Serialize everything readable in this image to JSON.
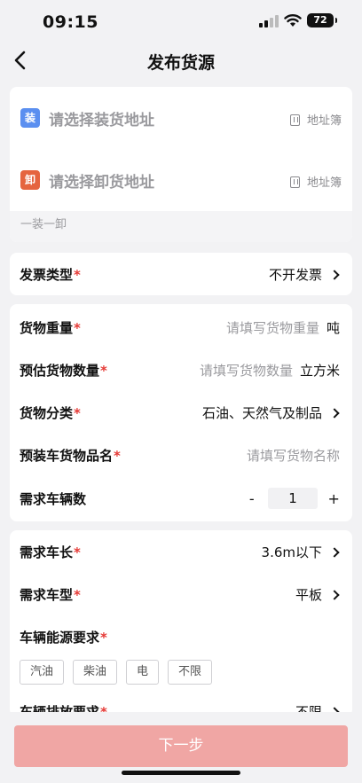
{
  "status": {
    "time": "09:15",
    "battery": "72"
  },
  "nav": {
    "title": "发布货源"
  },
  "address": {
    "load_badge": "装",
    "load_placeholder": "请选择装货地址",
    "unload_badge": "卸",
    "unload_placeholder": "请选择卸货地址",
    "book_label": "地址簿",
    "footer": "一装一卸"
  },
  "invoice": {
    "label": "发票类型",
    "value": "不开发票"
  },
  "cargo": {
    "weight": {
      "label": "货物重量",
      "placeholder": "请填写货物重量",
      "unit": "吨"
    },
    "quantity": {
      "label": "预估货物数量",
      "placeholder": "请填写货物数量",
      "unit": "立方米"
    },
    "category": {
      "label": "货物分类",
      "value": "石油、天然气及制品"
    },
    "name": {
      "label": "预装车货物品名",
      "placeholder": "请填写货物名称"
    },
    "vehicles": {
      "label": "需求车辆数",
      "minus": "-",
      "value": "1",
      "plus": "+"
    }
  },
  "vehicle": {
    "length": {
      "label": "需求车长",
      "value": "3.6m以下"
    },
    "type": {
      "label": "需求车型",
      "value": "平板"
    },
    "energy": {
      "label": "车辆能源要求",
      "options": [
        "汽油",
        "柴油",
        "电",
        "不限"
      ]
    },
    "emission": {
      "label": "车辆排放要求",
      "value": "不限"
    }
  },
  "required_mark": "*",
  "next_button": "下一步",
  "colors": {
    "accent": "#e53935",
    "next_button": "#f0a6a4",
    "load_badge": "#5b8ff0",
    "unload_badge": "#e5643f"
  }
}
